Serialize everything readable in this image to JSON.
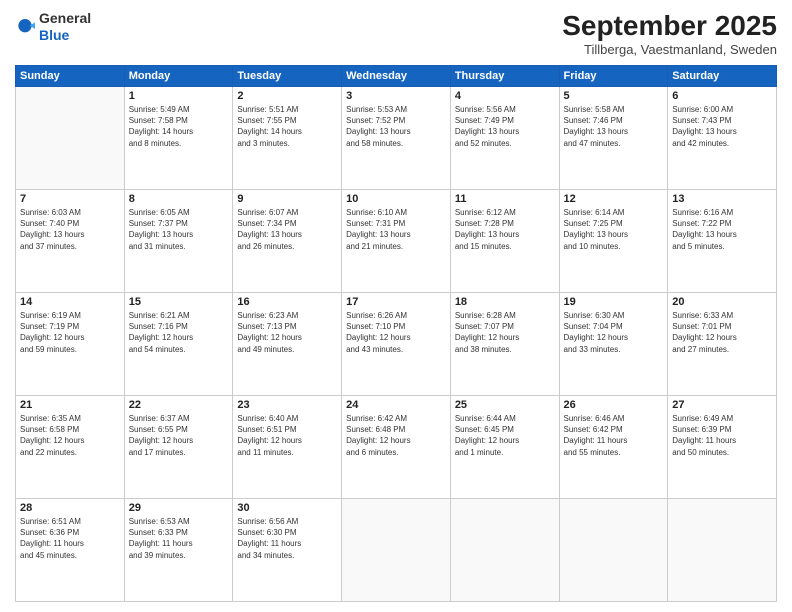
{
  "header": {
    "logo": {
      "general": "General",
      "blue": "Blue",
      "arrow_symbol": "▶"
    },
    "title": "September 2025",
    "location": "Tillberga, Vaestmanland, Sweden"
  },
  "weekdays": [
    "Sunday",
    "Monday",
    "Tuesday",
    "Wednesday",
    "Thursday",
    "Friday",
    "Saturday"
  ],
  "weeks": [
    [
      {
        "day": "",
        "info": ""
      },
      {
        "day": "1",
        "info": "Sunrise: 5:49 AM\nSunset: 7:58 PM\nDaylight: 14 hours\nand 8 minutes."
      },
      {
        "day": "2",
        "info": "Sunrise: 5:51 AM\nSunset: 7:55 PM\nDaylight: 14 hours\nand 3 minutes."
      },
      {
        "day": "3",
        "info": "Sunrise: 5:53 AM\nSunset: 7:52 PM\nDaylight: 13 hours\nand 58 minutes."
      },
      {
        "day": "4",
        "info": "Sunrise: 5:56 AM\nSunset: 7:49 PM\nDaylight: 13 hours\nand 52 minutes."
      },
      {
        "day": "5",
        "info": "Sunrise: 5:58 AM\nSunset: 7:46 PM\nDaylight: 13 hours\nand 47 minutes."
      },
      {
        "day": "6",
        "info": "Sunrise: 6:00 AM\nSunset: 7:43 PM\nDaylight: 13 hours\nand 42 minutes."
      }
    ],
    [
      {
        "day": "7",
        "info": "Sunrise: 6:03 AM\nSunset: 7:40 PM\nDaylight: 13 hours\nand 37 minutes."
      },
      {
        "day": "8",
        "info": "Sunrise: 6:05 AM\nSunset: 7:37 PM\nDaylight: 13 hours\nand 31 minutes."
      },
      {
        "day": "9",
        "info": "Sunrise: 6:07 AM\nSunset: 7:34 PM\nDaylight: 13 hours\nand 26 minutes."
      },
      {
        "day": "10",
        "info": "Sunrise: 6:10 AM\nSunset: 7:31 PM\nDaylight: 13 hours\nand 21 minutes."
      },
      {
        "day": "11",
        "info": "Sunrise: 6:12 AM\nSunset: 7:28 PM\nDaylight: 13 hours\nand 15 minutes."
      },
      {
        "day": "12",
        "info": "Sunrise: 6:14 AM\nSunset: 7:25 PM\nDaylight: 13 hours\nand 10 minutes."
      },
      {
        "day": "13",
        "info": "Sunrise: 6:16 AM\nSunset: 7:22 PM\nDaylight: 13 hours\nand 5 minutes."
      }
    ],
    [
      {
        "day": "14",
        "info": "Sunrise: 6:19 AM\nSunset: 7:19 PM\nDaylight: 12 hours\nand 59 minutes."
      },
      {
        "day": "15",
        "info": "Sunrise: 6:21 AM\nSunset: 7:16 PM\nDaylight: 12 hours\nand 54 minutes."
      },
      {
        "day": "16",
        "info": "Sunrise: 6:23 AM\nSunset: 7:13 PM\nDaylight: 12 hours\nand 49 minutes."
      },
      {
        "day": "17",
        "info": "Sunrise: 6:26 AM\nSunset: 7:10 PM\nDaylight: 12 hours\nand 43 minutes."
      },
      {
        "day": "18",
        "info": "Sunrise: 6:28 AM\nSunset: 7:07 PM\nDaylight: 12 hours\nand 38 minutes."
      },
      {
        "day": "19",
        "info": "Sunrise: 6:30 AM\nSunset: 7:04 PM\nDaylight: 12 hours\nand 33 minutes."
      },
      {
        "day": "20",
        "info": "Sunrise: 6:33 AM\nSunset: 7:01 PM\nDaylight: 12 hours\nand 27 minutes."
      }
    ],
    [
      {
        "day": "21",
        "info": "Sunrise: 6:35 AM\nSunset: 6:58 PM\nDaylight: 12 hours\nand 22 minutes."
      },
      {
        "day": "22",
        "info": "Sunrise: 6:37 AM\nSunset: 6:55 PM\nDaylight: 12 hours\nand 17 minutes."
      },
      {
        "day": "23",
        "info": "Sunrise: 6:40 AM\nSunset: 6:51 PM\nDaylight: 12 hours\nand 11 minutes."
      },
      {
        "day": "24",
        "info": "Sunrise: 6:42 AM\nSunset: 6:48 PM\nDaylight: 12 hours\nand 6 minutes."
      },
      {
        "day": "25",
        "info": "Sunrise: 6:44 AM\nSunset: 6:45 PM\nDaylight: 12 hours\nand 1 minute."
      },
      {
        "day": "26",
        "info": "Sunrise: 6:46 AM\nSunset: 6:42 PM\nDaylight: 11 hours\nand 55 minutes."
      },
      {
        "day": "27",
        "info": "Sunrise: 6:49 AM\nSunset: 6:39 PM\nDaylight: 11 hours\nand 50 minutes."
      }
    ],
    [
      {
        "day": "28",
        "info": "Sunrise: 6:51 AM\nSunset: 6:36 PM\nDaylight: 11 hours\nand 45 minutes."
      },
      {
        "day": "29",
        "info": "Sunrise: 6:53 AM\nSunset: 6:33 PM\nDaylight: 11 hours\nand 39 minutes."
      },
      {
        "day": "30",
        "info": "Sunrise: 6:56 AM\nSunset: 6:30 PM\nDaylight: 11 hours\nand 34 minutes."
      },
      {
        "day": "",
        "info": ""
      },
      {
        "day": "",
        "info": ""
      },
      {
        "day": "",
        "info": ""
      },
      {
        "day": "",
        "info": ""
      }
    ]
  ]
}
